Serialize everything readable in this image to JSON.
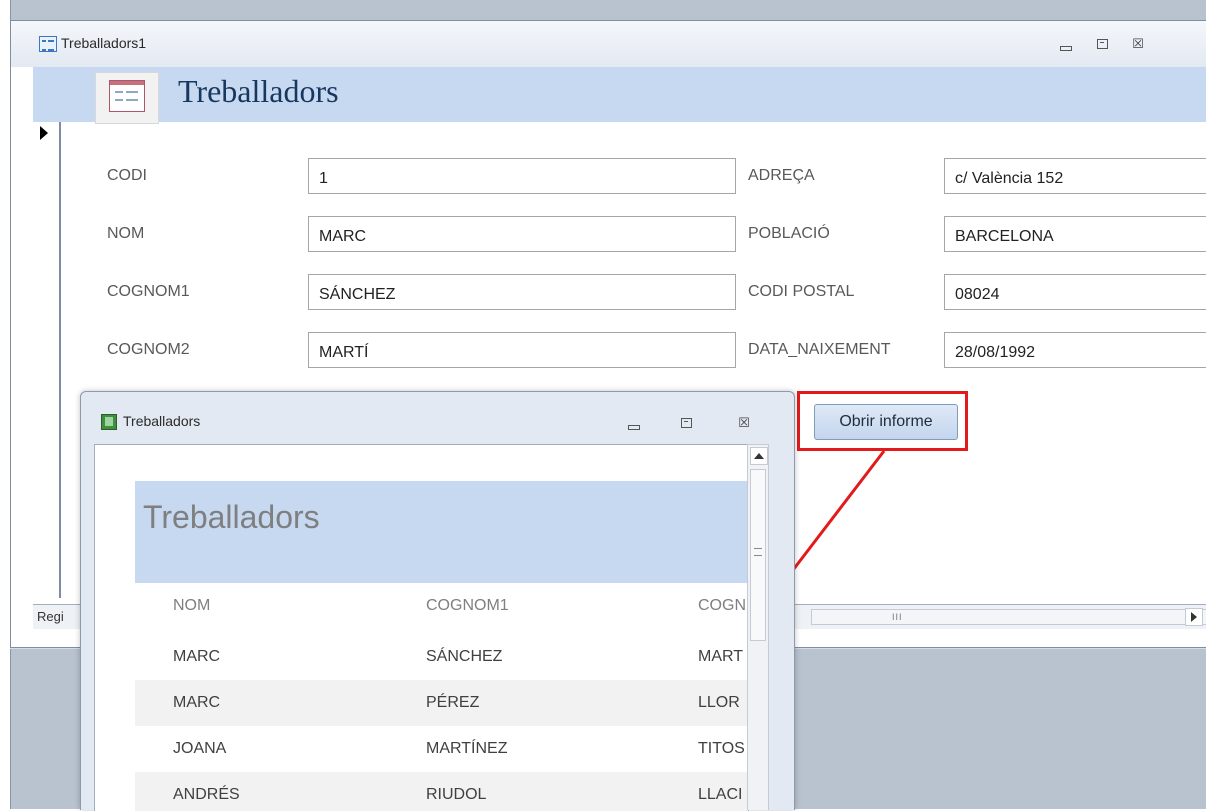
{
  "form": {
    "window_title": "Treballadors1",
    "header_title": "Treballadors",
    "fields_left": [
      {
        "label": "CODI",
        "value": "1"
      },
      {
        "label": "NOM",
        "value": "MARC"
      },
      {
        "label": "COGNOM1",
        "value": "SÁNCHEZ"
      },
      {
        "label": "COGNOM2",
        "value": "MARTÍ"
      }
    ],
    "fields_right": [
      {
        "label": "ADREÇA",
        "value": "c/ València 152"
      },
      {
        "label": "POBLACIÓ",
        "value": "BARCELONA"
      },
      {
        "label": "CODI POSTAL",
        "value": "08024"
      },
      {
        "label": "DATA_NAIXEMENT",
        "value": "28/08/1992"
      }
    ],
    "open_report_button": "Obrir informe",
    "status_record_label": "Regi",
    "status_scroll_grip": "III",
    "window_buttons": {
      "close": "☒"
    }
  },
  "report": {
    "window_title": "Treballadors",
    "title": "Treballadors",
    "columns": [
      "NOM",
      "COGNOM1",
      "COGN"
    ],
    "rows": [
      [
        "MARC",
        "SÁNCHEZ",
        "MART"
      ],
      [
        "MARC",
        "PÉREZ",
        "LLOR"
      ],
      [
        "JOANA",
        "MARTÍNEZ",
        "TITOS"
      ],
      [
        "ANDRÉS",
        "RIUDOL",
        "LLACI"
      ]
    ],
    "window_buttons": {
      "close": "☒"
    }
  },
  "colors": {
    "header_band": "#c6d9f1",
    "highlight_border": "#e31a1c"
  }
}
